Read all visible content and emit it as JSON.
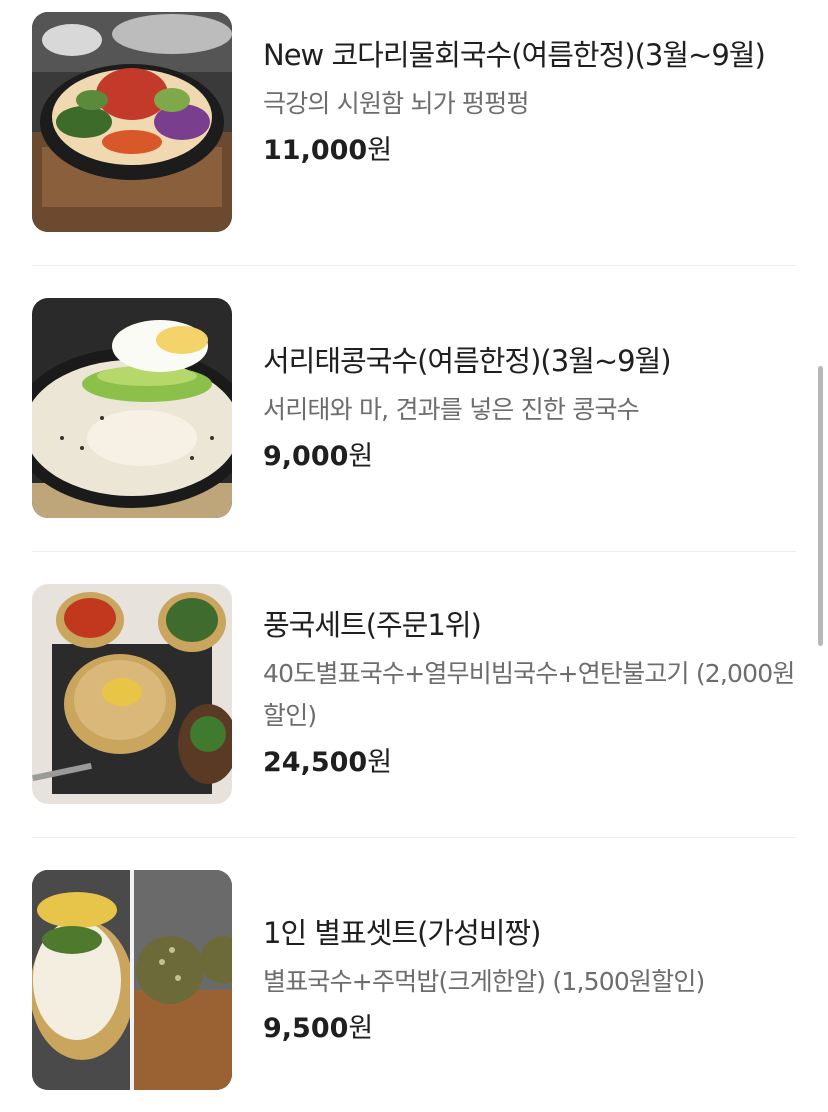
{
  "menu": {
    "items": [
      {
        "title": "New 코다리물회국수(여름한정)(3월~9월)",
        "description": "극강의 시원함 뇌가 펑펑펑",
        "price": "11,000",
        "currency": "원",
        "image_icon": "cold-noodle-bowl-photo"
      },
      {
        "title": "서리태콩국수(여름한정)(3월~9월)",
        "description": "서리태와 마, 견과를 넣은 진한 콩국수",
        "price": "9,000",
        "currency": "원",
        "image_icon": "soy-milk-noodle-photo"
      },
      {
        "title": "풍국세트(주문1위)",
        "description": "40도별표국수+열무비빔국수+연탄불고기 (2,000원할인)",
        "price": "24,500",
        "currency": "원",
        "image_icon": "set-meal-photo"
      },
      {
        "title": "1인 별표셋트(가성비짱)",
        "description": "별표국수+주먹밥(크게한알) (1,500원할인)",
        "price": "9,500",
        "currency": "원",
        "image_icon": "noodle-and-riceball-photo"
      }
    ]
  },
  "colors": {
    "title": "#1f1f1f",
    "description": "#6d6d6d",
    "divider": "#ececec",
    "scrollbar": "#b8b8b8"
  }
}
